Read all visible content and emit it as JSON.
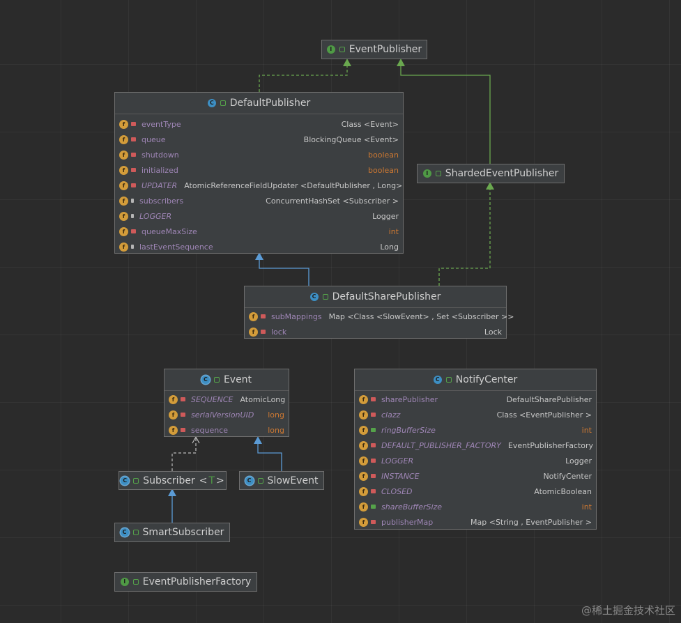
{
  "classes": {
    "event_publisher": {
      "name": "EventPublisher",
      "kind": "interface"
    },
    "default_publisher": {
      "name": "DefaultPublisher",
      "kind": "class",
      "fields": [
        {
          "name": "eventType",
          "type": "Class <Event>"
        },
        {
          "name": "queue",
          "type": "BlockingQueue <Event>"
        },
        {
          "name": "shutdown",
          "type": "boolean"
        },
        {
          "name": "initialized",
          "type": "boolean"
        },
        {
          "name": "UPDATER",
          "type": "AtomicReferenceFieldUpdater <DefaultPublisher , Long>"
        },
        {
          "name": "subscribers",
          "type": "ConcurrentHashSet <Subscriber >"
        },
        {
          "name": "LOGGER",
          "type": "Logger"
        },
        {
          "name": "queueMaxSize",
          "type": "int"
        },
        {
          "name": "lastEventSequence",
          "type": "Long"
        }
      ]
    },
    "sharded_event_publisher": {
      "name": "ShardedEventPublisher",
      "kind": "interface"
    },
    "default_share_publisher": {
      "name": "DefaultSharePublisher",
      "kind": "class",
      "fields": [
        {
          "name": "subMappings",
          "type": "Map <Class <SlowEvent> , Set <Subscriber >>"
        },
        {
          "name": "lock",
          "type": "Lock"
        }
      ]
    },
    "event": {
      "name": "Event",
      "kind": "abstract",
      "fields": [
        {
          "name": "SEQUENCE",
          "type": "AtomicLong"
        },
        {
          "name": "serialVersionUID",
          "type": "long"
        },
        {
          "name": "sequence",
          "type": "long"
        }
      ]
    },
    "subscriber": {
      "name": "Subscriber",
      "type_param_open": "<",
      "type_param": "T",
      "type_param_close": ">",
      "kind": "abstract"
    },
    "slow_event": {
      "name": "SlowEvent",
      "kind": "abstract"
    },
    "smart_subscriber": {
      "name": "SmartSubscriber",
      "kind": "abstract"
    },
    "event_publisher_factory": {
      "name": "EventPublisherFactory",
      "kind": "interface"
    },
    "notify_center": {
      "name": "NotifyCenter",
      "kind": "class",
      "fields": [
        {
          "name": "sharePublisher",
          "type": "DefaultSharePublisher"
        },
        {
          "name": "clazz",
          "type": "Class <EventPublisher >"
        },
        {
          "name": "ringBufferSize",
          "type": "int"
        },
        {
          "name": "DEFAULT_PUBLISHER_FACTORY",
          "type": "EventPublisherFactory"
        },
        {
          "name": "LOGGER",
          "type": "Logger"
        },
        {
          "name": "INSTANCE",
          "type": "NotifyCenter"
        },
        {
          "name": "CLOSED",
          "type": "AtomicBoolean"
        },
        {
          "name": "shareBufferSize",
          "type": "int"
        },
        {
          "name": "publisherMap",
          "type": "Map <String , EventPublisher >"
        }
      ]
    }
  },
  "colors": {
    "extends_edge": "#5b9bd5",
    "implements_edge": "#6aa84f",
    "dependency_edge": "#bbbbbb"
  },
  "watermark": "@稀土掘金技术社区"
}
